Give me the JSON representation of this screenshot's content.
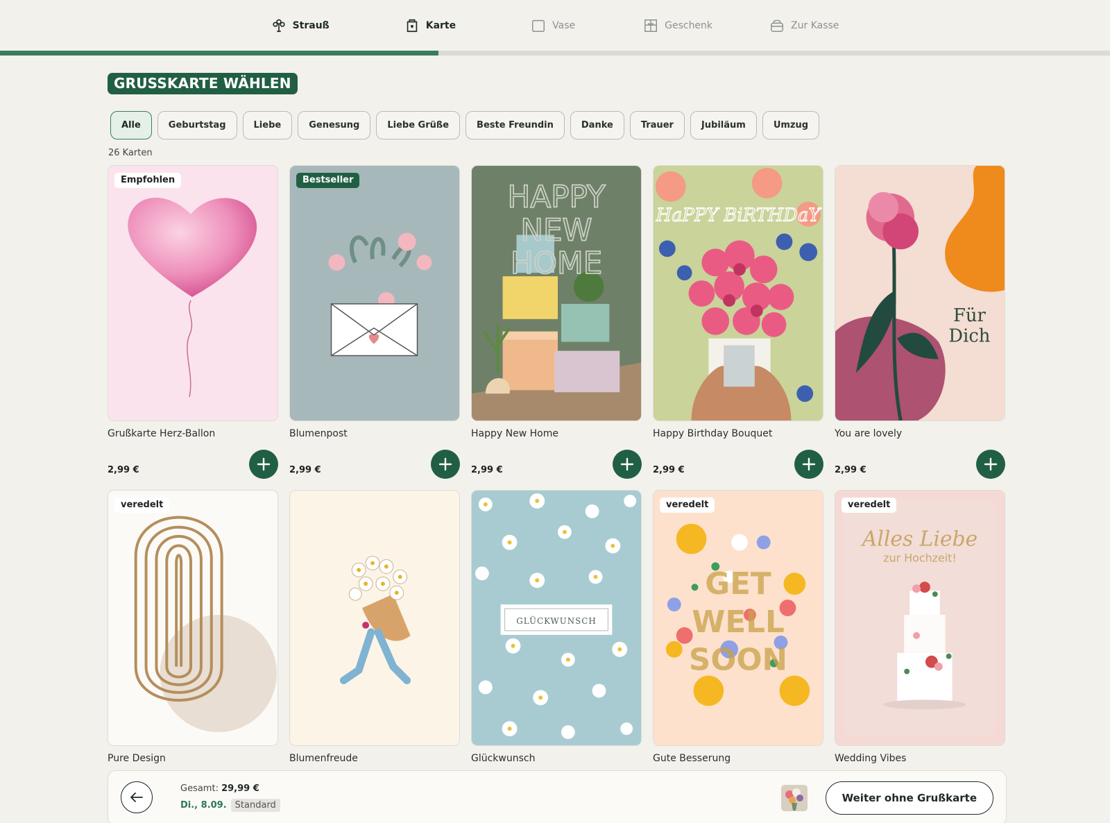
{
  "stepper": {
    "progress_percent": 39.5,
    "steps": [
      {
        "label": "Strauß",
        "icon": "bouquet-icon",
        "state": "done"
      },
      {
        "label": "Karte",
        "icon": "card-icon",
        "state": "active"
      },
      {
        "label": "Vase",
        "icon": "vase-icon",
        "state": "disabled"
      },
      {
        "label": "Geschenk",
        "icon": "gift-icon",
        "state": "disabled"
      },
      {
        "label": "Zur Kasse",
        "icon": "bag-icon",
        "state": "disabled"
      }
    ]
  },
  "header": {
    "title": "GRUSSKARTE WÄHLEN"
  },
  "filters": [
    "Alle",
    "Geburtstag",
    "Liebe",
    "Genesung",
    "Liebe Grüße",
    "Beste Freundin",
    "Danke",
    "Trauer",
    "Jubiläum",
    "Umzug"
  ],
  "active_filter": "Alle",
  "card_count": "26 Karten",
  "cards": [
    {
      "name": "Grußkarte Herz-Ballon",
      "price": "2,99 €",
      "badge": "Empfohlen"
    },
    {
      "name": "Blumenpost",
      "price": "2,99 €",
      "badge": "Bestseller"
    },
    {
      "name": "Happy New Home",
      "price": "2,99 €",
      "badge": "",
      "art_text": "HAPPY NEW HOME"
    },
    {
      "name": "Happy Birthday Bouquet",
      "price": "2,99 €",
      "badge": "",
      "art_text": "HaPPY BiRTHDaY"
    },
    {
      "name": "You are lovely",
      "price": "2,99 €",
      "badge": "",
      "art_text": "Für Dich"
    },
    {
      "name": "Pure Design",
      "price": "",
      "badge": "veredelt"
    },
    {
      "name": "Blumenfreude",
      "price": "",
      "badge": ""
    },
    {
      "name": "Glückwunsch",
      "price": "",
      "badge": "",
      "art_text": "GLÜCKWUNSCH"
    },
    {
      "name": "Gute Besserung",
      "price": "",
      "badge": "veredelt",
      "art_text": "GET WELL SOON"
    },
    {
      "name": "Wedding Vibes",
      "price": "",
      "badge": "veredelt",
      "art_text": "Alles Liebe zur Hochzeit!"
    }
  ],
  "footer": {
    "total_label": "Gesamt:",
    "total_value": "29,99 €",
    "delivery_date": "Di., 8.09.",
    "delivery_type": "Standard",
    "skip_button": "Weiter ohne Grußkarte"
  },
  "colors": {
    "brand_green": "#215f44",
    "progress": "#3a7d5c",
    "background": "#f3f1ec"
  }
}
